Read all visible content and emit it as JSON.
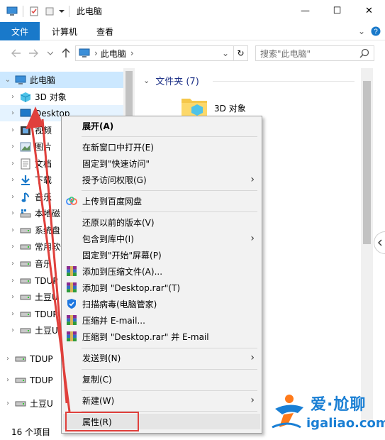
{
  "window": {
    "title": "此电脑",
    "minimize_glyph": "—",
    "maximize_glyph": "☐",
    "close_glyph": "✕",
    "help_glyph": "?",
    "ribbon_expand_glyph": "⌄"
  },
  "ribbon": {
    "tabs": [
      "文件",
      "计算机",
      "查看"
    ]
  },
  "address_bar": {
    "path": "此电脑",
    "chevron": "›",
    "dropdown": "⌄",
    "refresh": "↻"
  },
  "search": {
    "placeholder": "搜索\"此电脑\""
  },
  "navigation": {
    "items": [
      {
        "label": "此电脑",
        "icon": "computer-icon",
        "expanded": true
      },
      {
        "label": "3D 对象",
        "icon": "cube-icon"
      },
      {
        "label": "Desktop",
        "icon": "desktop-icon"
      },
      {
        "label": "视频",
        "icon": "video-icon"
      },
      {
        "label": "图片",
        "icon": "pictures-icon"
      },
      {
        "label": "文档",
        "icon": "document-icon"
      },
      {
        "label": "下载",
        "icon": "download-icon"
      },
      {
        "label": "音乐",
        "icon": "music-icon"
      },
      {
        "label": "本地磁",
        "icon": "windows-drive-icon"
      },
      {
        "label": "系统盘",
        "icon": "drive-icon"
      },
      {
        "label": "常用软件",
        "icon": "drive-icon"
      },
      {
        "label": "音乐",
        "icon": "drive-icon"
      },
      {
        "label": "TDUP",
        "icon": "drive-icon"
      },
      {
        "label": "土豆U",
        "icon": "drive-icon"
      },
      {
        "label": "TDUP",
        "icon": "drive-icon"
      },
      {
        "label": "土豆U",
        "icon": "drive-icon"
      },
      {
        "label": "TDUP",
        "icon": "drive-icon"
      },
      {
        "label": "TDUP",
        "icon": "drive-icon"
      },
      {
        "label": "土豆U",
        "icon": "drive-icon"
      }
    ]
  },
  "content": {
    "group_header": "文件夹 (7)",
    "items": [
      {
        "label": "3D 对象",
        "icon": "folder-3d-icon"
      }
    ]
  },
  "status_bar": {
    "item_count": "16 个项目"
  },
  "context_menu": {
    "items": [
      {
        "label": "展开(A)",
        "bold": true
      },
      {
        "separator": true
      },
      {
        "label": "在新窗口中打开(E)"
      },
      {
        "label": "固定到\"快速访问\""
      },
      {
        "label": "授予访问权限(G)",
        "submenu": true
      },
      {
        "separator": true
      },
      {
        "label": "上传到百度网盘",
        "icon": "baidu-cloud-icon"
      },
      {
        "separator": true
      },
      {
        "label": "还原以前的版本(V)"
      },
      {
        "label": "包含到库中(I)",
        "submenu": true
      },
      {
        "label": "固定到\"开始\"屏幕(P)"
      },
      {
        "label": "添加到压缩文件(A)...",
        "icon": "winrar-icon"
      },
      {
        "label": "添加到 \"Desktop.rar\"(T)",
        "icon": "winrar-icon"
      },
      {
        "label": "扫描病毒(电脑管家)",
        "icon": "shield-icon"
      },
      {
        "label": "压缩并 E-mail...",
        "icon": "winrar-icon"
      },
      {
        "label": "压缩到 \"Desktop.rar\" 并 E-mail",
        "icon": "winrar-icon"
      },
      {
        "separator": true
      },
      {
        "label": "发送到(N)",
        "submenu": true
      },
      {
        "separator": true
      },
      {
        "label": "复制(C)"
      },
      {
        "separator": true
      },
      {
        "label": "新建(W)",
        "submenu": true
      },
      {
        "separator": true
      },
      {
        "label": "属性(R)",
        "highlighted": true
      }
    ]
  },
  "watermark": {
    "brand_cn": "爱·尬聊",
    "brand_url": "igaliao.com"
  },
  "colors": {
    "accent": "#1979ca",
    "selection": "#cce8ff",
    "annotation_red": "#e0403c",
    "watermark_blue": "#1a7fd4"
  }
}
